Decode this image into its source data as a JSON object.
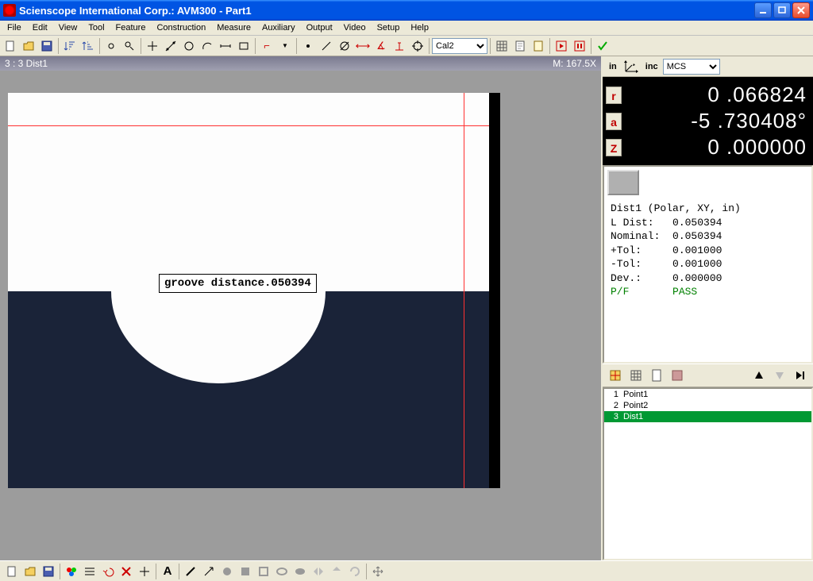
{
  "titlebar": {
    "title": "Scienscope International Corp.: AVM300 - Part1"
  },
  "menus": [
    "File",
    "Edit",
    "View",
    "Tool",
    "Feature",
    "Construction",
    "Measure",
    "Auxiliary",
    "Output",
    "Video",
    "Setup",
    "Help"
  ],
  "toolbar1": {
    "combo_cal": "Cal2"
  },
  "video": {
    "status_left": "3 : 3  Dist1",
    "status_right": "M: 167.5X",
    "annotation": "groove distance.050394"
  },
  "coord": {
    "unit": "in",
    "mode": "inc",
    "cs": "MCS"
  },
  "dro": {
    "rows": [
      {
        "lbl": "r",
        "val": "0 .066824"
      },
      {
        "lbl": "a",
        "val": "-5 .730408°"
      },
      {
        "lbl": "Z",
        "val": "0 .000000"
      }
    ]
  },
  "detail": {
    "header": "Dist1 (Polar, XY, in)",
    "l_label": "L Dist:",
    "l_val": "0.050394",
    "nom_label": "Nominal:",
    "nom_val": "0.050394",
    "ptol_label": "+Tol:",
    "ptol_val": "0.001000",
    "mtol_label": "-Tol:",
    "mtol_val": "0.001000",
    "dev_label": "Dev.:",
    "dev_val": "0.000000",
    "pf_label": "P/F",
    "pf_val": "PASS"
  },
  "features": [
    {
      "num": "1",
      "name": "Point1",
      "sel": false
    },
    {
      "num": "2",
      "name": "Point2",
      "sel": false
    },
    {
      "num": "3",
      "name": "Dist1",
      "sel": true
    }
  ]
}
